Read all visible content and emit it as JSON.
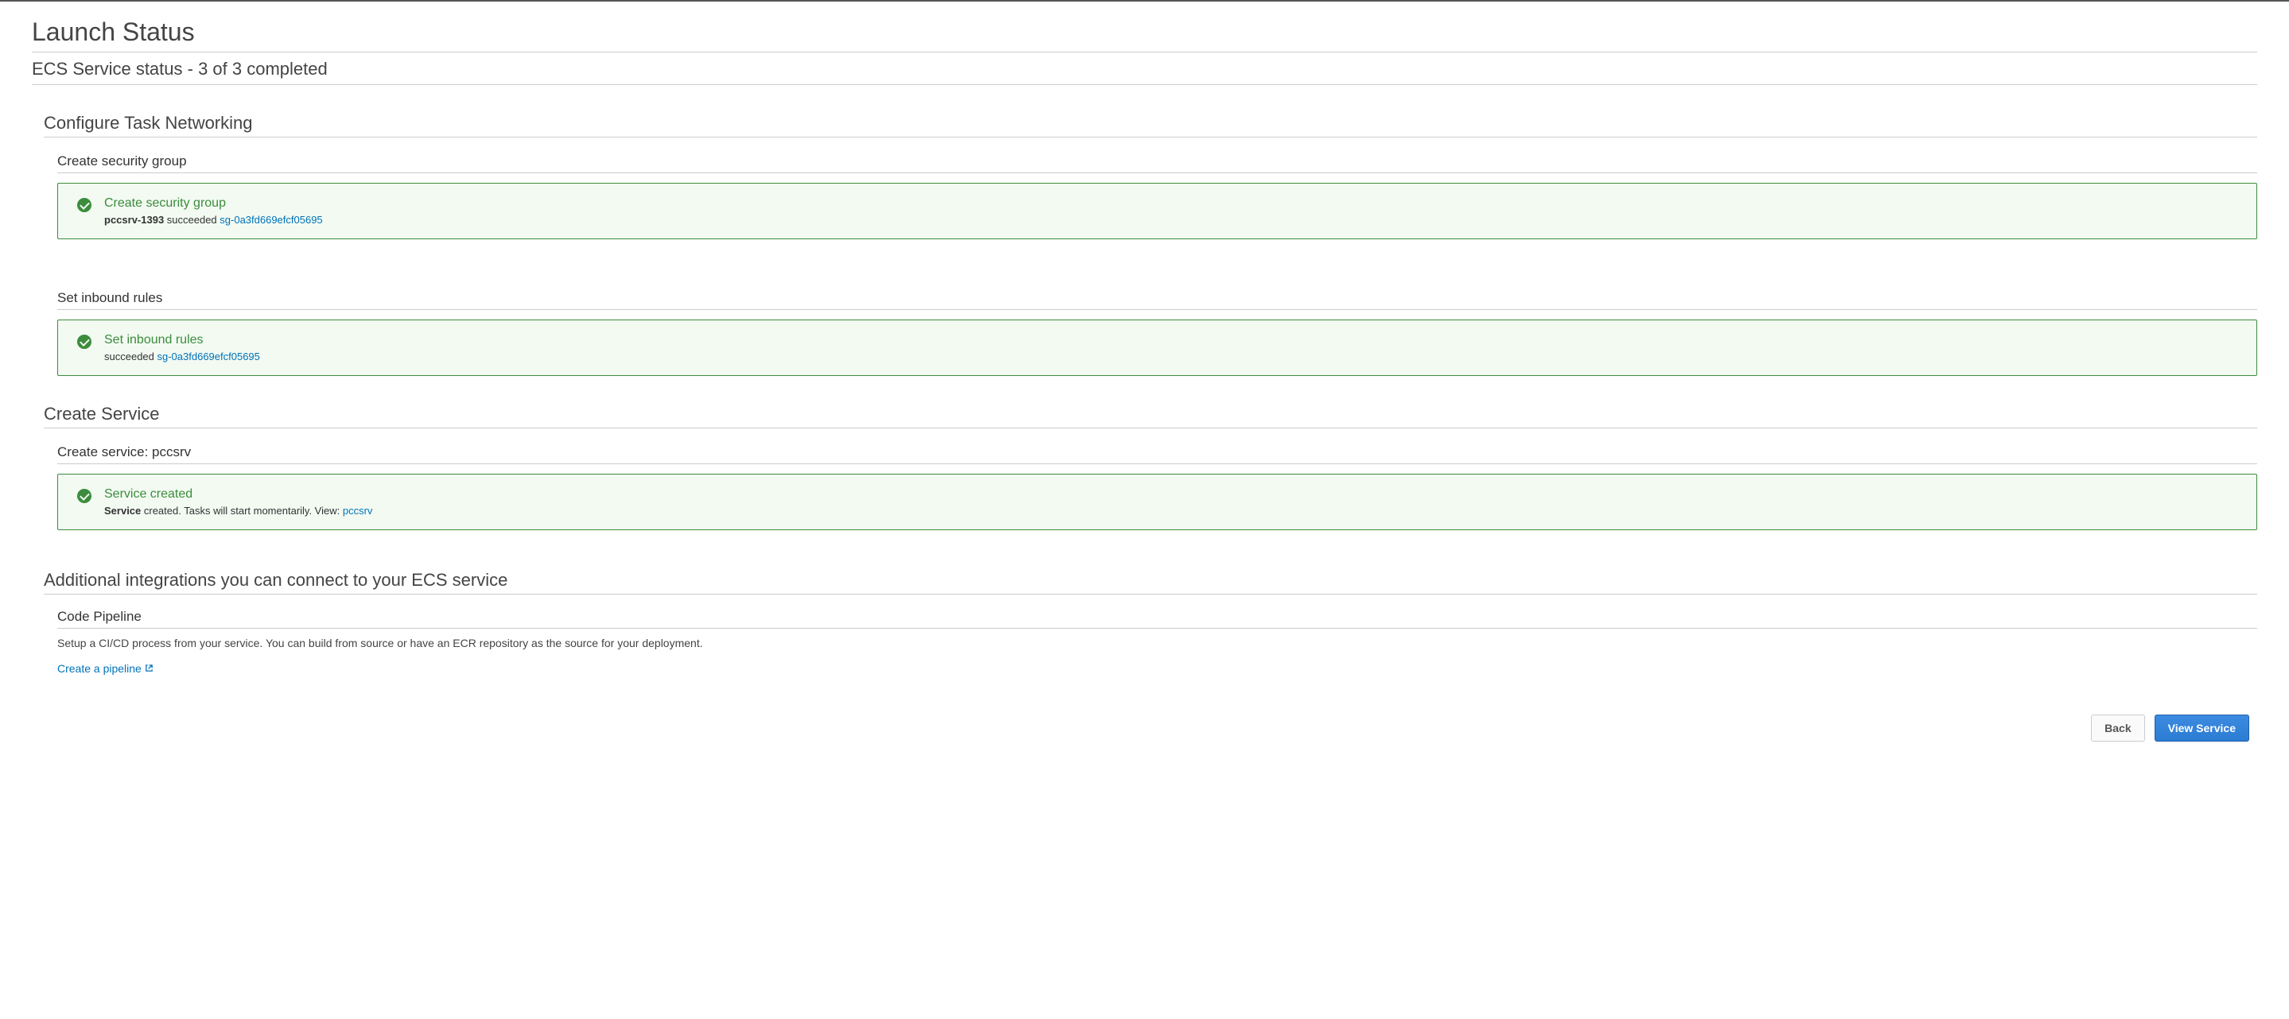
{
  "page_title": "Launch Status",
  "service_status": "ECS Service status - 3 of 3 completed",
  "sections": {
    "configure_networking": {
      "heading": "Configure Task Networking",
      "create_sg": {
        "label": "Create security group",
        "alert_title": "Create security group",
        "detail_bold": "pccsrv-1393",
        "detail_text": " succeeded ",
        "detail_link": "sg-0a3fd669efcf05695"
      },
      "inbound_rules": {
        "label": "Set inbound rules",
        "alert_title": "Set inbound rules",
        "detail_text": "succeeded ",
        "detail_link": "sg-0a3fd669efcf05695"
      }
    },
    "create_service": {
      "heading": "Create Service",
      "service": {
        "label": "Create service: pccsrv",
        "alert_title": "Service created",
        "detail_bold": "Service",
        "detail_text": " created. Tasks will start momentarily. View: ",
        "detail_link": "pccsrv"
      }
    },
    "additional": {
      "heading": "Additional integrations you can connect to your ECS service",
      "pipeline_heading": "Code Pipeline",
      "pipeline_desc": "Setup a CI/CD process from your service. You can build from source or have an ECR repository as the source for your deployment.",
      "pipeline_link": "Create a pipeline"
    }
  },
  "buttons": {
    "back": "Back",
    "view_service": "View Service"
  }
}
